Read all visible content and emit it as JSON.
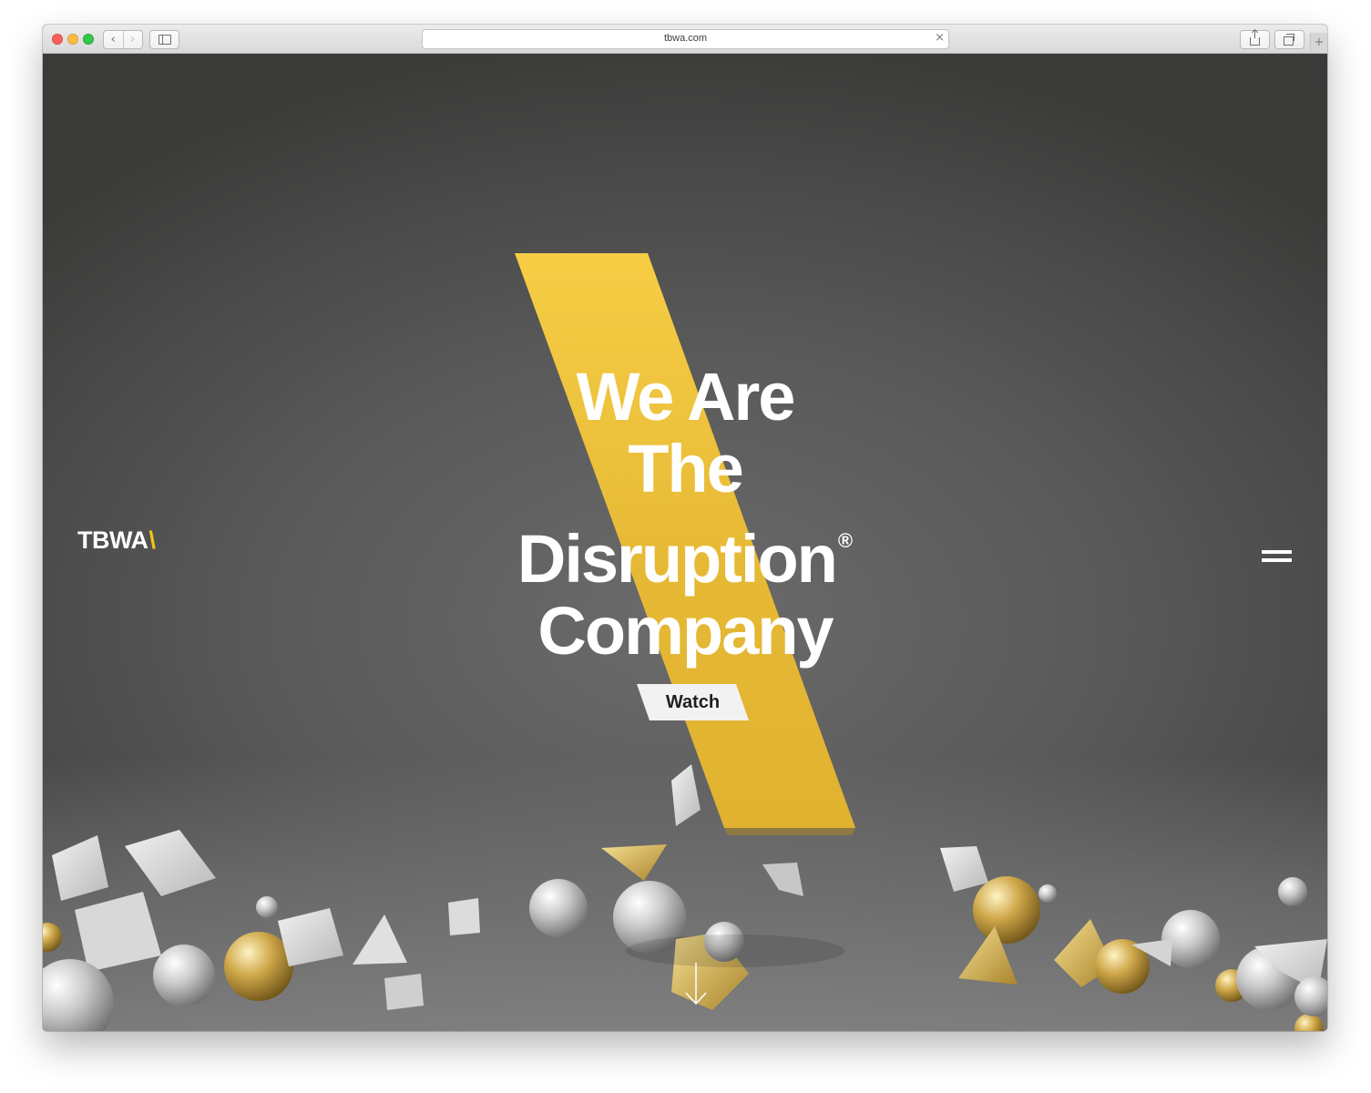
{
  "browser": {
    "url": "tbwa.com",
    "nav": {
      "back_icon": "‹",
      "forward_icon": "›"
    },
    "new_tab_icon": "+"
  },
  "page": {
    "logo": {
      "text": "TBWA",
      "slash": "\\"
    },
    "headline": {
      "line1": "We Are",
      "line2": "The",
      "line3": "Disruption",
      "registered": "®",
      "line4": "Company"
    },
    "cta_label": "Watch",
    "colors": {
      "brand_yellow": "#f5c518",
      "stripe_yellow": "#e9bb35",
      "background": "#5a5a5a",
      "text": "#ffffff",
      "button_bg": "#f2f2f2"
    }
  }
}
